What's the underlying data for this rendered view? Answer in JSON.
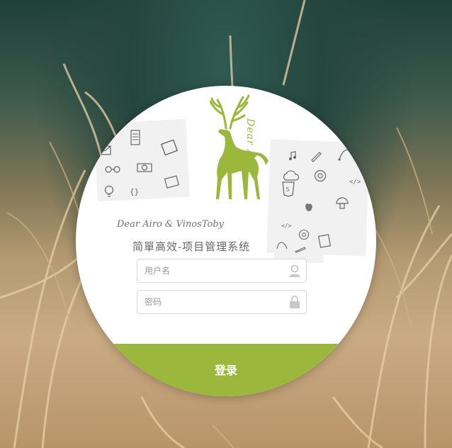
{
  "branding": {
    "logo_text": "Dear Airo",
    "credit": "Dear Airo & VinosToby",
    "system_title": "简單高效-项目管理系统"
  },
  "form": {
    "username_placeholder": "用户名",
    "password_placeholder": "密码",
    "login_label": "登录"
  },
  "colors": {
    "accent": "#9bb83c",
    "card": "#ffffff"
  },
  "icons": {
    "user": "user-icon",
    "lock": "lock-icon"
  }
}
